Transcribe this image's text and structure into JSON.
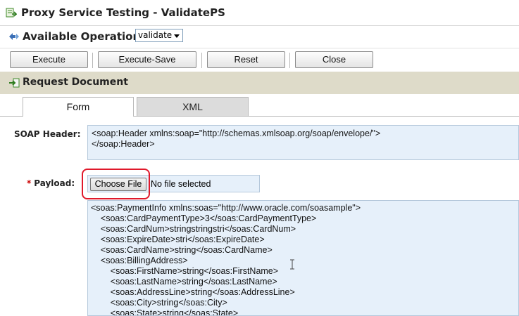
{
  "title": {
    "text": "Proxy Service Testing - ValidatePS"
  },
  "operations": {
    "label": "Available Operations:",
    "selected": "validate"
  },
  "toolbar": {
    "execute": "Execute",
    "execute_save": "Execute-Save",
    "reset": "Reset",
    "close": "Close"
  },
  "request_document": {
    "title": "Request Document",
    "tabs": [
      "Form",
      "XML"
    ],
    "active_tab": "Form"
  },
  "form": {
    "soap_header_label": "SOAP Header:",
    "soap_header_value": "<soap:Header xmlns:soap=\"http://schemas.xmlsoap.org/soap/envelope/\">\n</soap:Header>",
    "payload_label": "Payload:",
    "payload_required_marker": "*",
    "choose_file": "Choose File",
    "file_status": "No file selected",
    "payload_value": "<soas:PaymentInfo xmlns:soas=\"http://www.oracle.com/soasample\">\n    <soas:CardPaymentType>3</soas:CardPaymentType>\n    <soas:CardNum>stringstringstri</soas:CardNum>\n    <soas:ExpireDate>stri</soas:ExpireDate>\n    <soas:CardName>string</soas:CardName>\n    <soas:BillingAddress>\n        <soas:FirstName>string</soas:FirstName>\n        <soas:LastName>string</soas:LastName>\n        <soas:AddressLine>string</soas:AddressLine>\n        <soas:City>string</soas:City>\n        <soas:State>string</soas:State>"
  },
  "colors": {
    "accent_ring": "#e0192b",
    "field_bg": "#e6f0fa",
    "section_bg": "#dedbc9"
  }
}
